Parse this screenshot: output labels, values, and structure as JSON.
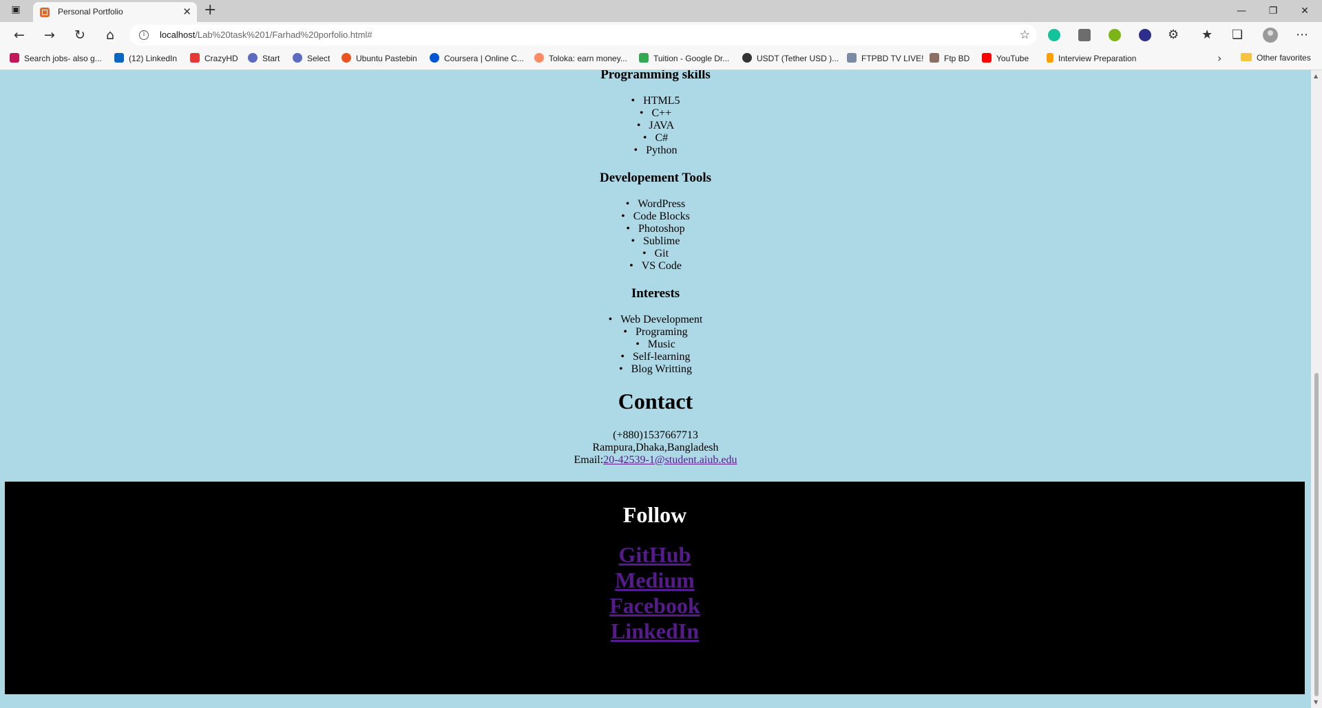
{
  "browser": {
    "tab_title": "Personal Portfolio",
    "url_host": "localhost",
    "url_path": "/Lab%20task%201/Farhad%20porfolio.html#"
  },
  "bookmarks": [
    {
      "label": "Search jobs- also g...",
      "color": "#c2185b"
    },
    {
      "label": "(12) LinkedIn",
      "color": "#0a66c2"
    },
    {
      "label": "CrazyHD",
      "color": "#e53935"
    },
    {
      "label": "Start",
      "color": "#5c6bc0"
    },
    {
      "label": "Select",
      "color": "#5c6bc0"
    },
    {
      "label": "Ubuntu Pastebin",
      "color": "#e95420"
    },
    {
      "label": "Coursera | Online C...",
      "color": "#0056d2"
    },
    {
      "label": "Toloka: earn money...",
      "color": "#ff8a65"
    },
    {
      "label": "Tuition - Google Dr...",
      "color": "#34a853"
    },
    {
      "label": "USDT (Tether USD )...",
      "color": "#333333"
    },
    {
      "label": "FTPBD TV LIVE!",
      "color": "#7b8aa5"
    },
    {
      "label": "Ftp BD",
      "color": "#8d6e63"
    },
    {
      "label": "YouTube",
      "color": "#ff0000"
    },
    {
      "label": "Interview Preparation",
      "color": "#ffa000"
    }
  ],
  "other_favorites": "Other favorites",
  "page": {
    "programming": {
      "heading": "Programming skills",
      "items": [
        "HTML5",
        "C++",
        "JAVA",
        "C#",
        "Python"
      ]
    },
    "tools": {
      "heading": "Developement Tools",
      "items": [
        "WordPress",
        "Code Blocks",
        "Photoshop",
        "Sublime",
        "Git",
        "VS Code"
      ]
    },
    "interests": {
      "heading": "Interests",
      "items": [
        "Web Development",
        "Programing",
        "Music",
        "Self-learning",
        "Blog Writting"
      ]
    },
    "contact": {
      "heading": "Contact",
      "phone": "(+880)1537667713",
      "address": "Rampura,Dhaka,Bangladesh",
      "email_label": "Email:",
      "email": "20-42539-1@student.aiub.edu"
    },
    "footer": {
      "heading": "Follow",
      "links": [
        "GitHub",
        "Medium",
        "Facebook",
        "LinkedIn"
      ]
    }
  }
}
